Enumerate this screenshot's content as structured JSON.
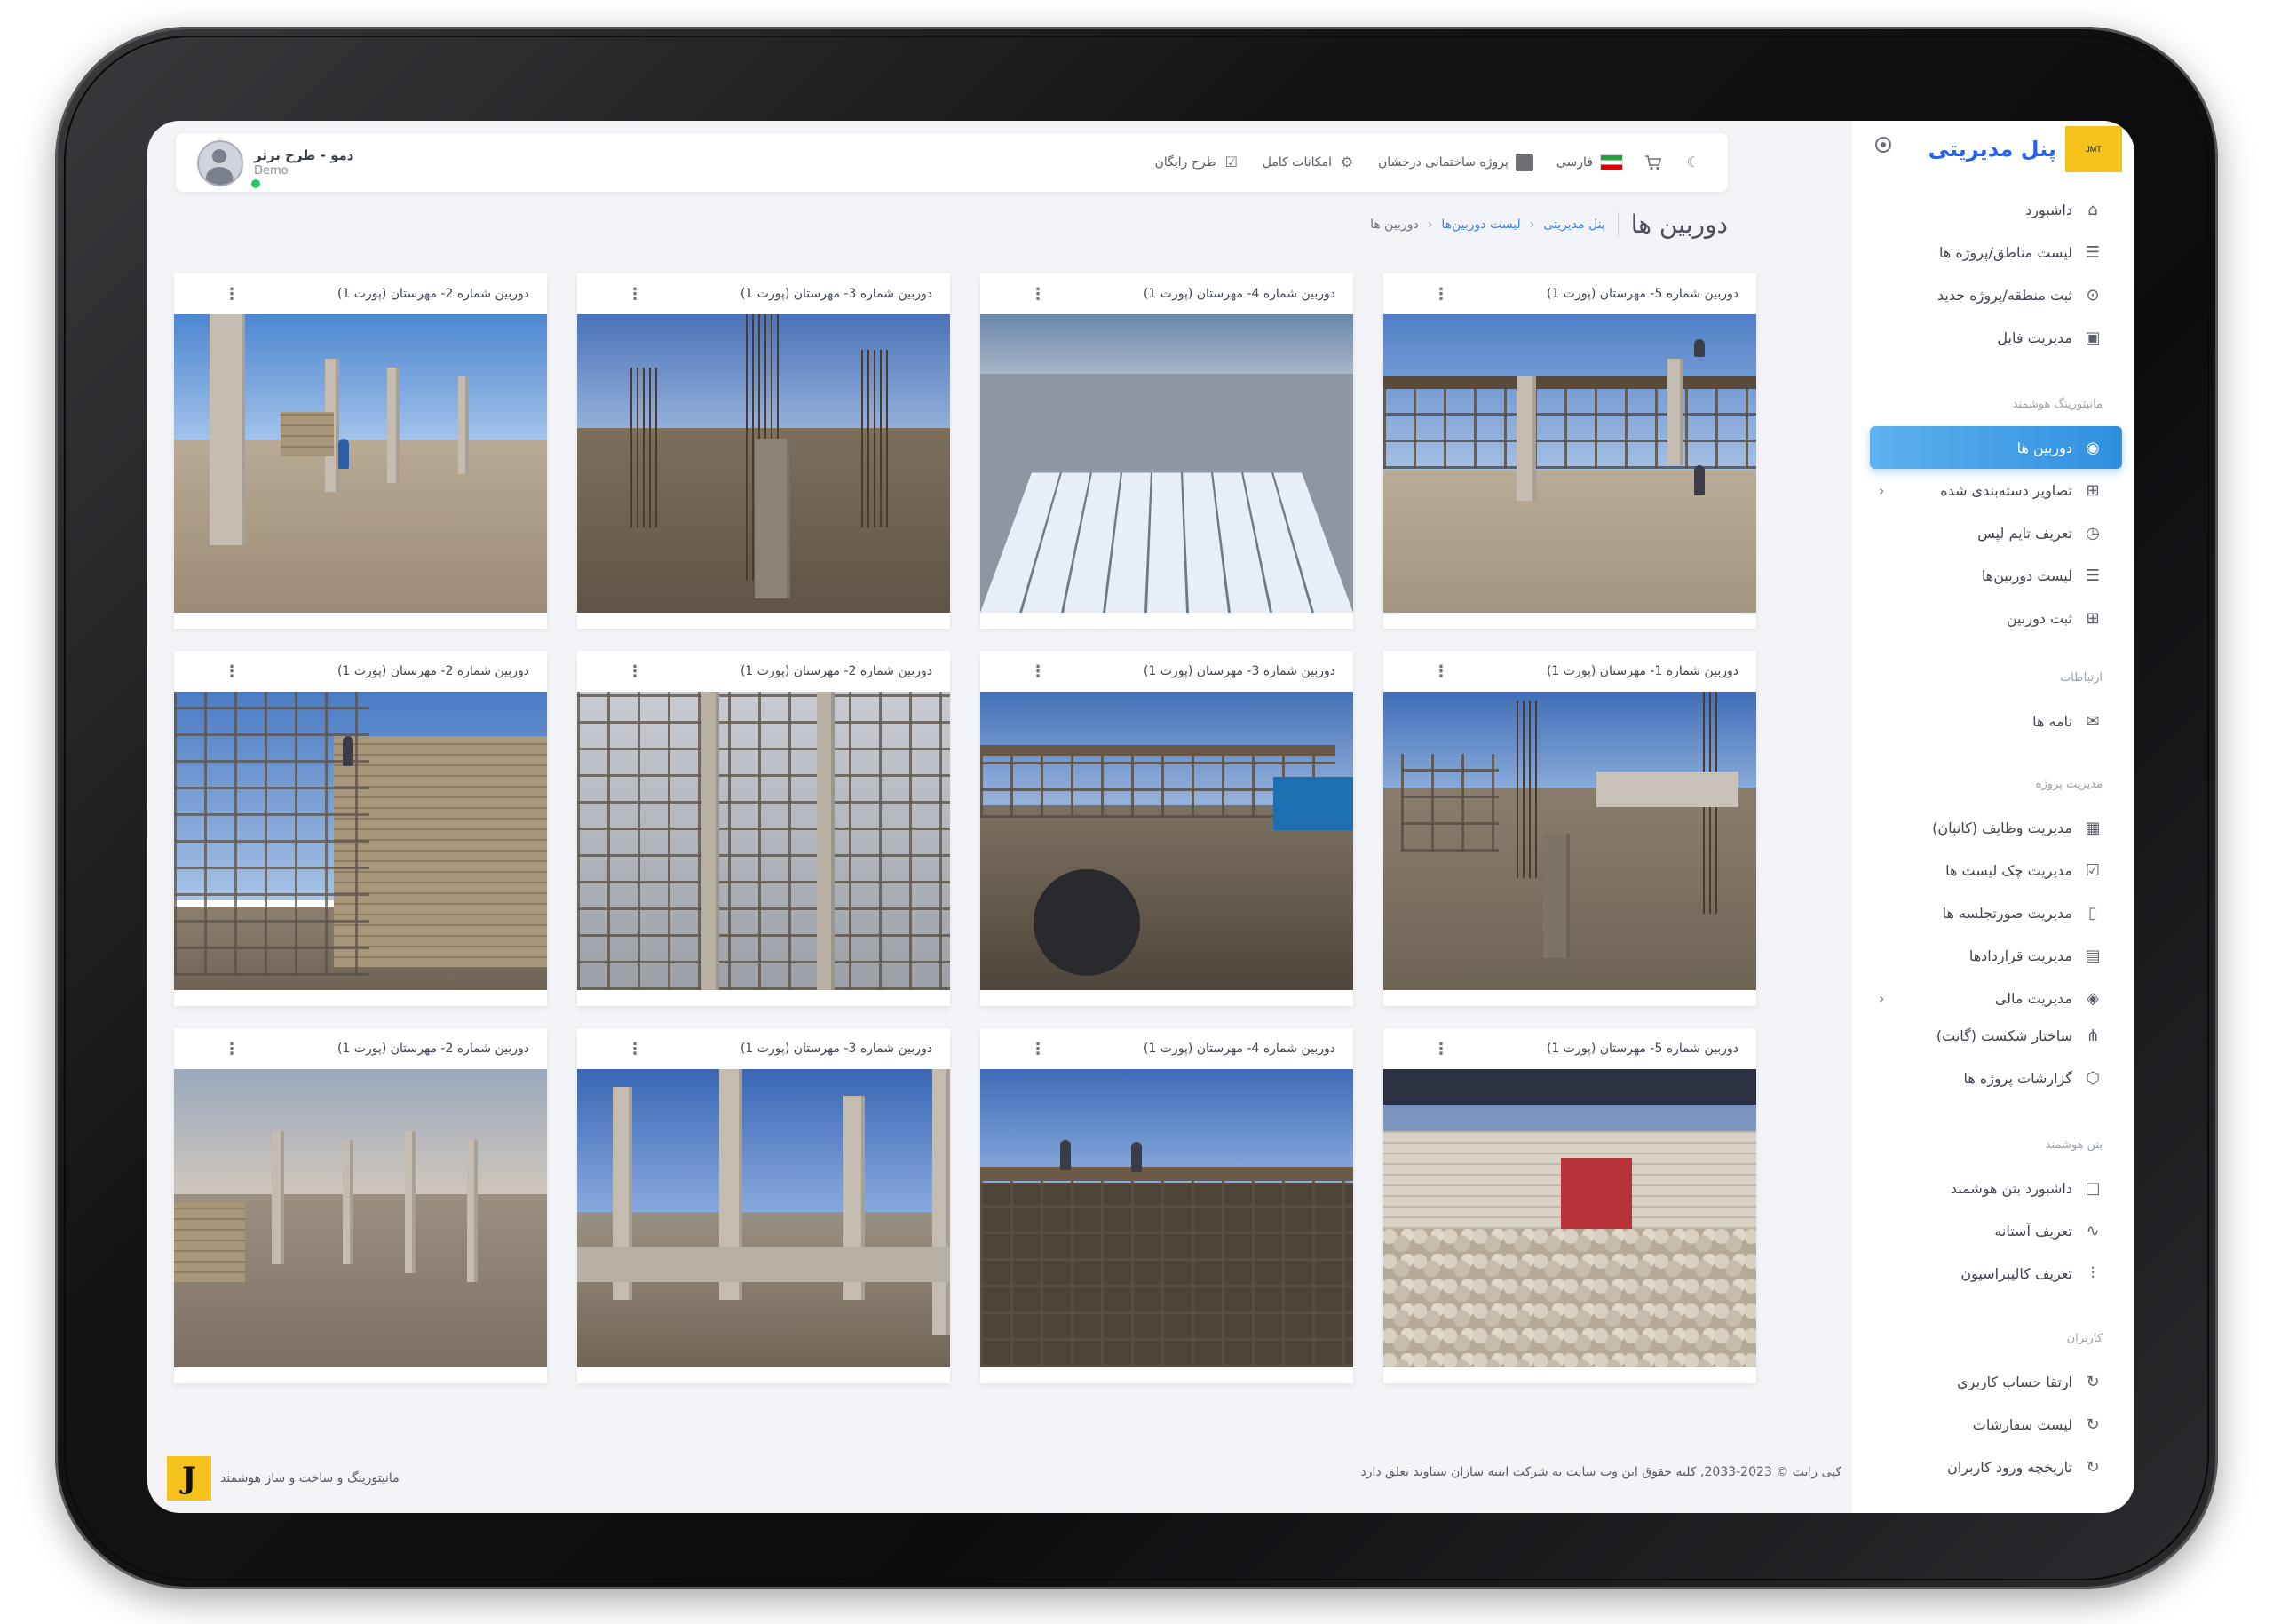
{
  "app": {
    "brand": "پنل مدیریتی",
    "brand_logo_text": "JMT"
  },
  "header": {
    "user_name": "دمو - طرح برتر",
    "user_role": "Demo",
    "nav": [
      {
        "label": "",
        "icon": "moon-icon"
      },
      {
        "label": "",
        "icon": "cart-icon"
      },
      {
        "label": "فارسی",
        "icon": "iran-flag-icon"
      },
      {
        "label": "پروژه ساختمانی درخشان",
        "icon": "project-thumb-icon"
      },
      {
        "label": "امکانات کامل",
        "icon": "gear-icon"
      },
      {
        "label": "طرح رایگان",
        "icon": "checkbox-icon"
      }
    ]
  },
  "page": {
    "title": "دوربین ها",
    "breadcrumb": [
      "پنل مدیریتی",
      "لیست دوربین‌ها",
      "دوربین ها"
    ]
  },
  "cameras": [
    {
      "title": "دوربین شماره 5- مهرستان (پورت 1)",
      "scene": "columns-building"
    },
    {
      "title": "دوربین شماره 4- مهرستان (پورت 1)",
      "scene": "formwork-roof"
    },
    {
      "title": "دوربین شماره 3- مهرستان (پورت 1)",
      "scene": "rebar-columns"
    },
    {
      "title": "دوربین شماره 2- مهرستان (پورت 1)",
      "scene": "concrete-columns"
    },
    {
      "title": "دوربین شماره 1- مهرستان (پورت 1)",
      "scene": "rebar-site"
    },
    {
      "title": "دوربین شماره 3- مهرستان (پورت 1)",
      "scene": "building-container"
    },
    {
      "title": "دوربین شماره 2- مهرستان (پورت 1)",
      "scene": "scaffold"
    },
    {
      "title": "دوربین شماره 2- مهرستان (پورت 1)",
      "scene": "block-wall-scaffold"
    },
    {
      "title": "دوربین شماره 5- مهرستان (پورت 1)",
      "scene": "warehouse-rubble"
    },
    {
      "title": "دوربین شماره 4- مهرستان (پورت 1)",
      "scene": "workers-roof"
    },
    {
      "title": "دوربین شماره 3- مهرستان (پورت 1)",
      "scene": "foundations-columns"
    },
    {
      "title": "دوربین شماره 2- مهرستان (پورت 1)",
      "scene": "columns-dusk"
    }
  ],
  "sidebar": {
    "items": [
      {
        "label": "داشبورد",
        "icon": "home-icon",
        "section": null
      },
      {
        "label": "لیست مناطق/پروژه ها",
        "icon": "list-icon"
      },
      {
        "label": "ثبت منطقه/پروژه جدید",
        "icon": "location-pin-icon"
      },
      {
        "label": "مدیریت فایل",
        "icon": "save-icon"
      },
      {
        "label": "دوربین ها",
        "icon": "camera-icon",
        "active": true
      },
      {
        "label": "تصاویر دسته‌بندی شده",
        "icon": "grid-icon",
        "chevron": true
      },
      {
        "label": "تعریف تایم لپس",
        "icon": "timer-icon"
      },
      {
        "label": "لیست دوربین‌ها",
        "icon": "list-icon"
      },
      {
        "label": "ثبت دوربین",
        "icon": "plus-square-icon"
      },
      {
        "label": "نامه ها",
        "icon": "mail-icon"
      },
      {
        "label": "مدیریت وظایف (کانبان)",
        "icon": "kanban-icon"
      },
      {
        "label": "مدیریت چک لیست ها",
        "icon": "checklist-icon"
      },
      {
        "label": "مدیریت صورتجلسه ها",
        "icon": "file-icon"
      },
      {
        "label": "مدیریت قراردادها",
        "icon": "file-text-icon"
      },
      {
        "label": "مدیریت مالی",
        "icon": "layers-icon",
        "chevron": true
      },
      {
        "label": "ساختار شکست (گانت)",
        "icon": "hierarchy-icon"
      },
      {
        "label": "گزارشات پروژه ها",
        "icon": "box-icon"
      },
      {
        "label": "داشبورد بتن هوشمند",
        "icon": "square-icon"
      },
      {
        "label": "تعریف آستانه",
        "icon": "pulse-icon"
      },
      {
        "label": "تعریف کالیبراسیون",
        "icon": "sliders-icon"
      },
      {
        "label": "ارتقا حساب کاربری",
        "icon": "refresh-icon"
      },
      {
        "label": "لیست سفارشات",
        "icon": "refresh-icon"
      },
      {
        "label": "تاریخچه ورود کاربران",
        "icon": "refresh-icon"
      }
    ],
    "sections": {
      "monitoring": "مانیتورینگ هوشمند",
      "communications": "ارتباطات",
      "project_management": "مدیریت پروژه",
      "smart_concrete": "بتن هوشمند",
      "users": "کاربران"
    }
  },
  "footer": {
    "copyright": "کپی رایت © 2023-2033, کلیه حقوق این وب سایت به شرکت ابنیه سازان ستاوند تعلق دارد",
    "tagline": "مانیتورینگ و ساخت و ساز هوشمند",
    "logo_letter": "J"
  }
}
